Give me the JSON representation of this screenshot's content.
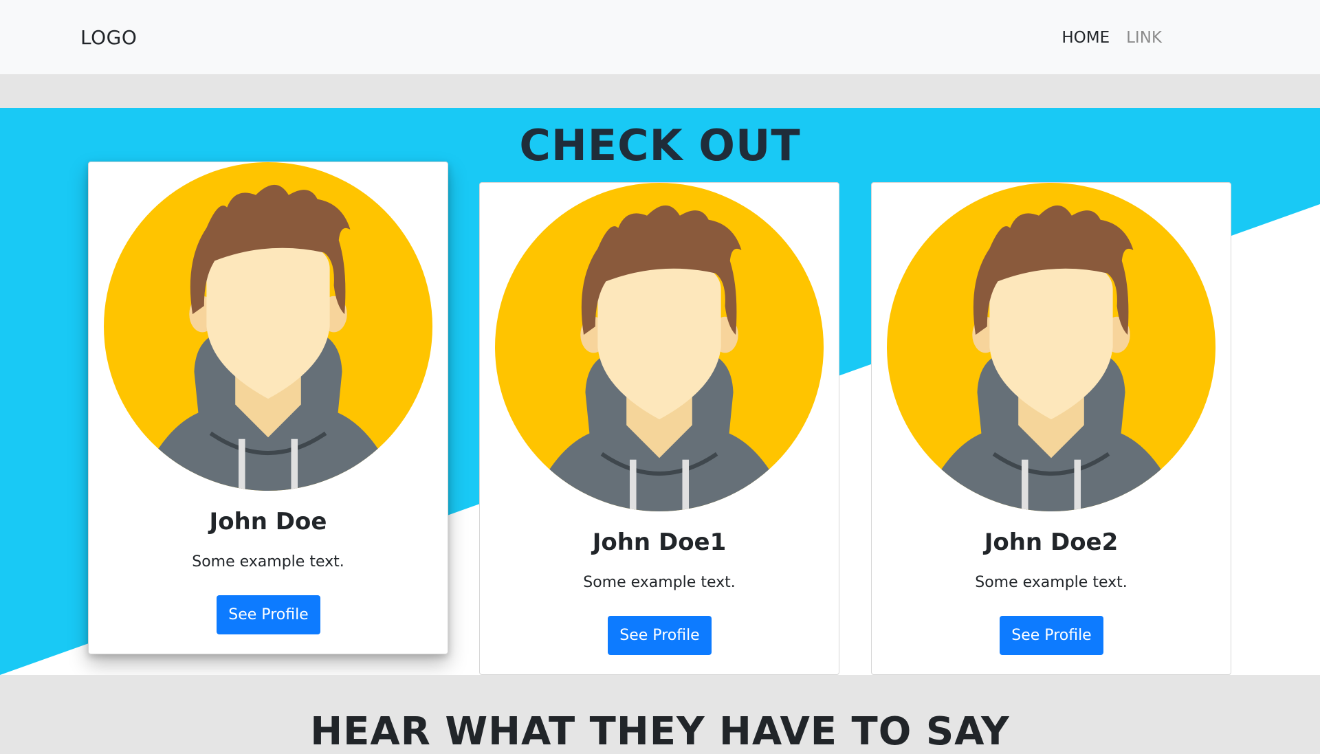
{
  "navbar": {
    "logo": "LOGO",
    "links": [
      {
        "label": "HOME"
      },
      {
        "label": "LINK"
      }
    ]
  },
  "hero": {
    "title": "CHECK OUT",
    "cards": [
      {
        "name": "John Doe",
        "text": "Some example text.",
        "button": "See Profile"
      },
      {
        "name": "John Doe1",
        "text": "Some example text.",
        "button": "See Profile"
      },
      {
        "name": "John Doe2",
        "text": "Some example text.",
        "button": "See Profile"
      }
    ]
  },
  "testimonials": {
    "title": "HEAR WHAT THEY HAVE TO SAY"
  },
  "colors": {
    "accent_blue": "#19c9f5",
    "button_blue": "#0d7bff",
    "avatar_yellow": "#ffc400"
  },
  "icons": {
    "avatar": "user-avatar-icon"
  }
}
